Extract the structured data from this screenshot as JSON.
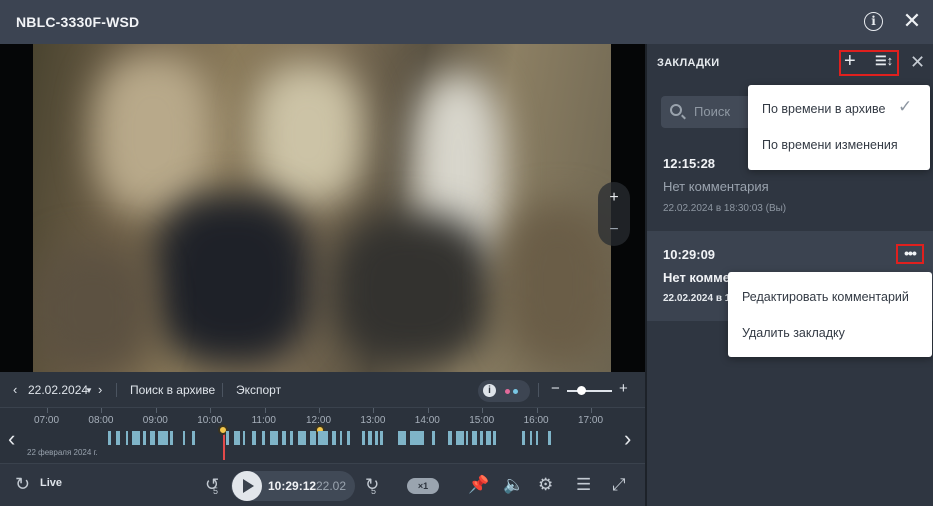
{
  "window": {
    "title": "NBLC-3330F-WSD"
  },
  "player_toolbar": {
    "date": "22.02.2024",
    "archive_search": "Поиск в архиве",
    "export": "Экспорт",
    "info_glyph": "i"
  },
  "zoom": {
    "plus": "+",
    "minus": "−"
  },
  "timeline": {
    "hours": [
      "07:00",
      "08:00",
      "09:00",
      "10:00",
      "11:00",
      "12:00",
      "13:00",
      "14:00",
      "15:00",
      "16:00",
      "17:00"
    ],
    "date_caption": "22 февраля 2024 г.",
    "cursor_color": "#e34a4a",
    "record_color": "#7fb4c8",
    "bookmark_color": "#f3c64a"
  },
  "player": {
    "live_label": "Live",
    "rewind_label": "5",
    "forward_label": "5",
    "time": "10:29:12",
    "date": "22.02",
    "speed": "×1"
  },
  "panel": {
    "title": "ЗАКЛАДКИ",
    "search_placeholder": "Поиск",
    "sort_menu": {
      "items": [
        "По времени в архиве",
        "По времени изменения"
      ],
      "selected_index": 0
    },
    "bookmarks": [
      {
        "time": "12:15:28",
        "comment": "Нет комментария",
        "meta": "22.02.2024 в 18:30:03 (Вы)"
      },
      {
        "time": "10:29:09",
        "comment": "Нет комментария",
        "meta": "22.02.2024 в 18:30:03 (Вы)"
      }
    ],
    "context_menu": {
      "items": [
        "Редактировать комментарий",
        "Удалить закладку"
      ]
    }
  },
  "colors": {
    "highlight": "#e0201e",
    "panel_bg": "#2f3641",
    "selected_bookmark_bg": "#3b4350"
  }
}
